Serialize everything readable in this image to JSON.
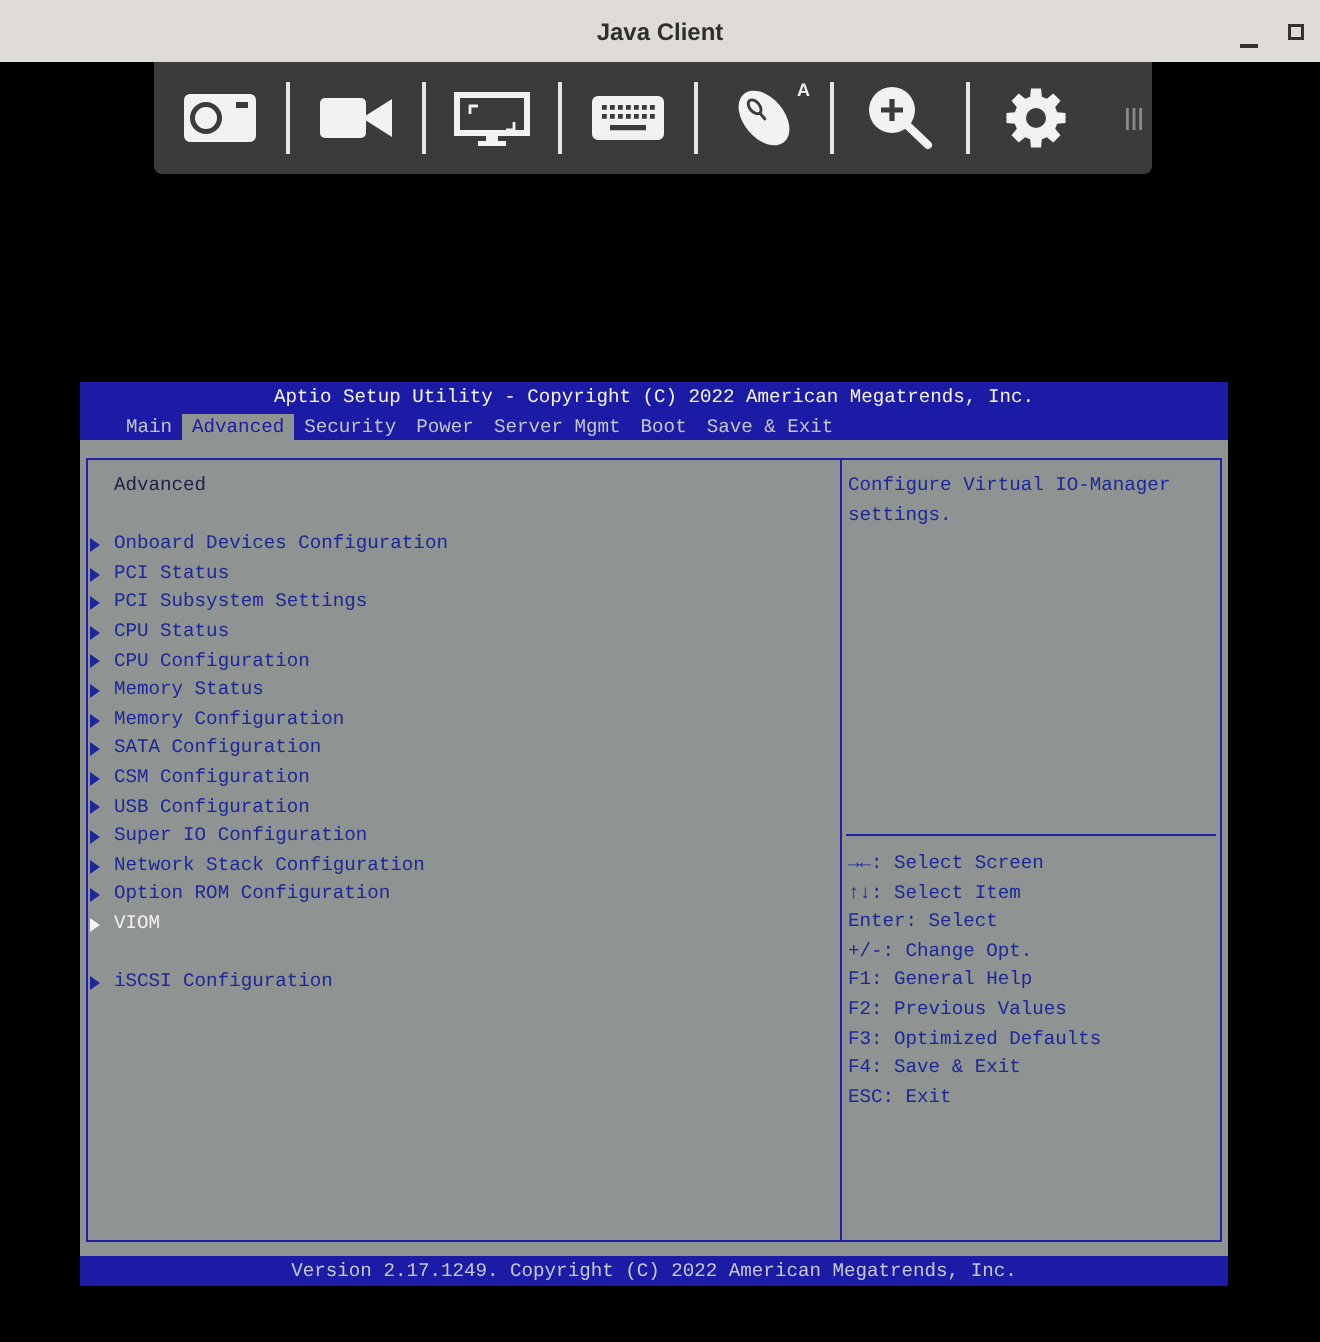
{
  "window": {
    "title": "Java Client"
  },
  "toolbar": {
    "buttons": [
      {
        "kind": "camera"
      },
      {
        "kind": "video"
      },
      {
        "kind": "monitor"
      },
      {
        "kind": "keyboard"
      },
      {
        "kind": "mouse",
        "badge": "A"
      },
      {
        "kind": "zoom"
      },
      {
        "kind": "settings"
      }
    ]
  },
  "bios": {
    "title": "Aptio Setup Utility - Copyright (C) 2022 American Megatrends, Inc.",
    "tabs": [
      {
        "label": "Main",
        "selected": false
      },
      {
        "label": "Advanced",
        "selected": true
      },
      {
        "label": "Security",
        "selected": false
      },
      {
        "label": "Power",
        "selected": false
      },
      {
        "label": "Server Mgmt",
        "selected": false
      },
      {
        "label": "Boot",
        "selected": false
      },
      {
        "label": "Save & Exit",
        "selected": false
      }
    ],
    "heading": "Advanced",
    "menu_groups": [
      [
        {
          "label": "Onboard Devices Configuration",
          "selected": false
        },
        {
          "label": "PCI Status",
          "selected": false
        },
        {
          "label": "PCI Subsystem Settings",
          "selected": false
        },
        {
          "label": "CPU Status",
          "selected": false
        },
        {
          "label": "CPU Configuration",
          "selected": false
        },
        {
          "label": "Memory Status",
          "selected": false
        },
        {
          "label": "Memory Configuration",
          "selected": false
        },
        {
          "label": "SATA Configuration",
          "selected": false
        },
        {
          "label": "CSM Configuration",
          "selected": false
        },
        {
          "label": "USB Configuration",
          "selected": false
        },
        {
          "label": "Super IO Configuration",
          "selected": false
        },
        {
          "label": "Network Stack Configuration",
          "selected": false
        },
        {
          "label": "Option ROM Configuration",
          "selected": false
        },
        {
          "label": "VIOM",
          "selected": true
        }
      ],
      [
        {
          "label": "iSCSI Configuration",
          "selected": false
        }
      ]
    ],
    "help_text": "Configure Virtual IO-Manager settings.",
    "key_help": [
      "→←: Select Screen",
      "↑↓: Select Item",
      "Enter: Select",
      "+/-: Change Opt.",
      "F1: General Help",
      "F2: Previous Values",
      "F3: Optimized Defaults",
      "F4: Save & Exit",
      "ESC: Exit"
    ],
    "footer": "Version 2.17.1249. Copyright (C) 2022 American Megatrends, Inc."
  }
}
